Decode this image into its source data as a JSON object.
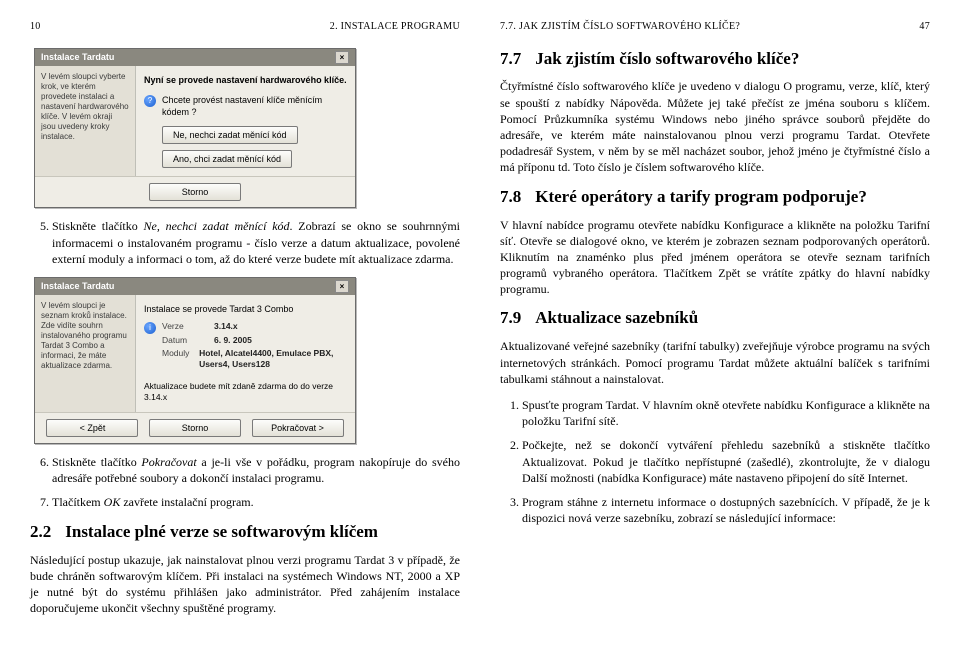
{
  "left": {
    "header_num": "10",
    "header_text": "2. INSTALACE PROGRAMU",
    "step5_pre": "Stiskněte tlačítko ",
    "step5_btn": "Ne, nechci zadat měnící kód",
    "step5_post": ". Zobrazí se okno se souhrnnými informacemi o instalovaném programu - číslo verze a datum aktualizace, povolené externí moduly a informaci o tom, až do které verze budete mít aktualizace zdarma.",
    "step6_pre": "Stiskněte tlačítko ",
    "step6_btn": "Pokračovat",
    "step6_post": " a je-li vše v pořádku, program nakopíruje do svého adresáře potřebné soubory a dokončí instalaci programu.",
    "step7_pre": "Tlačítkem ",
    "step7_btn": "OK",
    "step7_post": " zavřete instalační program.",
    "sec22_num": "2.2",
    "sec22_title": "Instalace plné verze se softwarovým klíčem",
    "sec22_body": "Následující postup ukazuje, jak nainstalovat plnou verzi programu Tardat 3 v případě, že bude chráněn softwarovým klíčem. Při instalaci na systémech Windows NT, 2000 a XP je nutné být do systému přihlášen jako administrátor. Před zahájením instalace doporučujeme ukončit všechny spuštěné programy."
  },
  "right": {
    "header_text": "7.7. JAK ZJISTÍM ČÍSLO SOFTWAROVÉHO KLÍČE?",
    "header_num": "47",
    "sec77_num": "7.7",
    "sec77_title": "Jak zjistím číslo softwarového klíče?",
    "p77": "Čtyřmístné číslo softwarového klíče je uvedeno v dialogu O programu, verze, klíč, který se spouští z nabídky Nápověda. Můžete jej také přečíst ze jména souboru s klíčem. Pomocí Průzkumníka systému Windows nebo jiného správce souborů přejděte do adresáře, ve kterém máte nainstalovanou plnou verzi programu Tardat. Otevřete podadresář System, v něm by se měl nacházet soubor, jehož jméno je čtyřmístné číslo a má příponu td. Toto číslo je číslem softwarového klíče.",
    "sec78_num": "7.8",
    "sec78_title": "Které operátory a tarify program podporuje?",
    "p78": "V hlavní nabídce programu otevřete nabídku Konfigurace a klikněte na položku Tarifní síť. Otevře se dialogové okno, ve kterém je zobrazen seznam podporovaných operátorů. Kliknutím na znaménko plus před jménem operátora se otevře seznam tarifních programů vybraného operátora. Tlačítkem Zpět se vrátíte zpátky do hlavní nabídky programu.",
    "sec79_num": "7.9",
    "sec79_title": "Aktualizace sazebníků",
    "p79": "Aktualizované veřejné sazebníky (tarifní tabulky) zveřejňuje výrobce programu na svých internetových stránkách. Pomocí programu Tardat můžete aktuální balíček s tarifními tabulkami stáhnout a nainstalovat.",
    "step1": "Spusťte program Tardat. V hlavním okně otevřete nabídku Konfigurace a klikněte na položku Tarifní sítě.",
    "step2": "Počkejte, než se dokončí vytváření přehledu sazebníků a stiskněte tlačítko Aktualizovat. Pokud je tlačítko nepřístupné (zašedlé), zkontrolujte, že v dialogu Další možnosti (nabídka Konfigurace) máte nastaveno připojení do sítě Internet.",
    "step3": "Program stáhne z internetu informace o dostupných sazebnících. V případě, že je k dispozici nová verze sazebníku, zobrazí se následující informace:"
  },
  "dialog1": {
    "title": "Instalace Tardatu",
    "side": "V levém sloupci vyberte krok, ve kterém provedete instalaci a nastavení hardwarového klíče. V levém okraji jsou uvedeny kroky instalace.",
    "mainbold": "Nyní se provede nastavení hardwarového klíče.",
    "question": "Chcete provést nastavení klíče měnícím kódem ?",
    "btn_no": "Ne, nechci zadat měnící kód",
    "btn_yes": "Ano, chci zadat měnící kód",
    "btn_close": "Storno",
    "q_icon": "?"
  },
  "dialog2": {
    "title": "Instalace Tardatu",
    "side": "V levém sloupci je seznam kroků instalace. Zde vidíte souhrn instalovaného programu Tardat 3 Combo a informaci, že máte aktualizace zdarma.",
    "mainline": "Instalace se provede Tardat 3 Combo",
    "verse_lbl": "Verze",
    "verse_val": "3.14.x",
    "datum_lbl": "Datum",
    "datum_val": "6. 9. 2005",
    "moduly_lbl": "Moduly",
    "moduly_val": "Hotel, Alcatel4400, Emulace PBX, Users4, Users128",
    "note": "Aktualizace budete mít zdaně zdarma do do verze 3.14.x",
    "btn_back": "< Zpět",
    "btn_cancel": "Storno",
    "btn_next": "Pokračovat >",
    "info_icon": "i"
  }
}
